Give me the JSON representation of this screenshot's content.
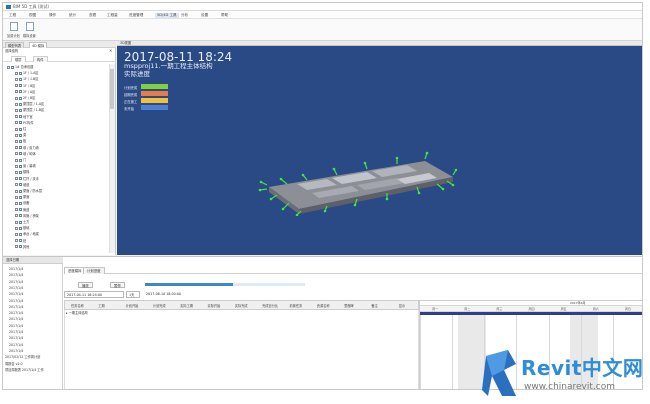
{
  "window": {
    "title": "BIM 5D 工具 (测试)",
    "menus": [
      {
        "label": "工程"
      },
      {
        "label": "视图"
      },
      {
        "label": "操作"
      },
      {
        "label": "统计"
      },
      {
        "label": "查看"
      },
      {
        "label": "工程量"
      },
      {
        "label": "进度管理"
      },
      {
        "label": "5D/4D 工具"
      },
      {
        "label": "分析"
      },
      {
        "label": "设置"
      },
      {
        "label": "帮助"
      }
    ],
    "active_menu_index": 7
  },
  "ribbon": {
    "buttons": [
      {
        "label": "加载计划",
        "icon": "document-icon"
      },
      {
        "label": "模拟设置",
        "icon": "document-icon"
      }
    ]
  },
  "left_panel": {
    "tabs": [
      {
        "label": "模型列表"
      },
      {
        "label": "4D 模拟"
      }
    ],
    "header_label": "选择结构",
    "close_label": "×",
    "subtabs": [
      {
        "label": "楼层"
      },
      {
        "label": "构件"
      }
    ],
    "tree": [
      {
        "label": "1# 总承包楼",
        "level": 0
      },
      {
        "label": "1F / 1-A区",
        "level": 1
      },
      {
        "label": "1F / 1-B区",
        "level": 1
      },
      {
        "label": "1F / B区",
        "level": 1
      },
      {
        "label": "2F / A区",
        "level": 1
      },
      {
        "label": "2F / B区",
        "level": 1
      },
      {
        "label": "屋顶层 / 1-A区",
        "level": 1
      },
      {
        "label": "屋顶层 / 1-B区",
        "level": 1
      },
      {
        "label": "地下室",
        "level": 1
      },
      {
        "label": "PC构件",
        "level": 1
      },
      {
        "label": "柱",
        "level": 1
      },
      {
        "label": "梁",
        "level": 1
      },
      {
        "label": "板",
        "level": 1
      },
      {
        "label": "墙 / 剪力墙",
        "level": 1
      },
      {
        "label": "墙 / 砌体",
        "level": 1
      },
      {
        "label": "门",
        "level": 1
      },
      {
        "label": "窗 / 幕墙",
        "level": 1
      },
      {
        "label": "楼梯",
        "level": 1
      },
      {
        "label": "栏杆 / 扶手",
        "level": 1
      },
      {
        "label": "坡道",
        "level": 1
      },
      {
        "label": "屋面 / 防水层",
        "level": 1
      },
      {
        "label": "屋面",
        "level": 1
      },
      {
        "label": "设备",
        "level": 1
      },
      {
        "label": "管道",
        "level": 1
      },
      {
        "label": "风管 / 桥架",
        "level": 1
      },
      {
        "label": "土方",
        "level": 1
      },
      {
        "label": "基础",
        "level": 1
      },
      {
        "label": "承台 / 地梁",
        "level": 1
      },
      {
        "label": "桩",
        "level": 1
      },
      {
        "label": "其他",
        "level": 1
      }
    ]
  },
  "viewport": {
    "tab_label": "3D视图",
    "datetime": "2017-08-11  18:24",
    "project": "mspproj11.一期工程主体结构",
    "mode": "实际进度",
    "legend": [
      {
        "label": "计划完成",
        "color": "#7ed23f"
      },
      {
        "label": "延期完成",
        "color": "#e77b4d"
      },
      {
        "label": "正在施工",
        "color": "#f3c03c"
      },
      {
        "label": "未开始",
        "color": "#4a7fd1"
      }
    ]
  },
  "bottom": {
    "left_header": "选择日期",
    "dates": [
      "2017/1/4",
      "2017/1/4",
      "2017/1/4",
      "2017/1/4",
      "2017/1/4",
      "2017/1/4",
      "2017/1/4",
      "2017/1/4",
      "2017/1/4",
      "2017/1/4",
      "2017/1/4",
      "2017/1/4",
      "2017/1/4",
      "2017/1/4",
      "2017/02/12 工作周计划",
      "周报告 v2.0",
      "项目周报表 2017/1/4 工作"
    ],
    "tabs": [
      {
        "label": "进度模拟"
      },
      {
        "label": "计划进度"
      }
    ],
    "toolbar": {
      "play_label": "播放",
      "stop_label": "暂停",
      "start_date": "2017-04-11 18:24:00",
      "step_label": "1天",
      "end_date": "2017-06-10 18:00:00",
      "progress": 0.55
    },
    "columns": [
      {
        "label": "任务名称"
      },
      {
        "label": "工期"
      },
      {
        "label": "计划开始"
      },
      {
        "label": "计划完成"
      },
      {
        "label": "实际工期"
      },
      {
        "label": "实际开始"
      },
      {
        "label": "实际完成"
      },
      {
        "label": "完成百分比"
      },
      {
        "label": "前置任务"
      },
      {
        "label": "资源名称"
      },
      {
        "label": "里程碑"
      },
      {
        "label": "备注"
      },
      {
        "label": "显示"
      }
    ],
    "rows": [
      {
        "label": "一期主体结构"
      }
    ],
    "gantt": {
      "header": "2017年6月",
      "days": [
        "周一",
        "周二",
        "周三",
        "周四",
        "周五",
        "周六",
        "周日"
      ]
    }
  },
  "watermark": {
    "brand": "Revit中文网",
    "url": "www.chinarevit.com"
  }
}
